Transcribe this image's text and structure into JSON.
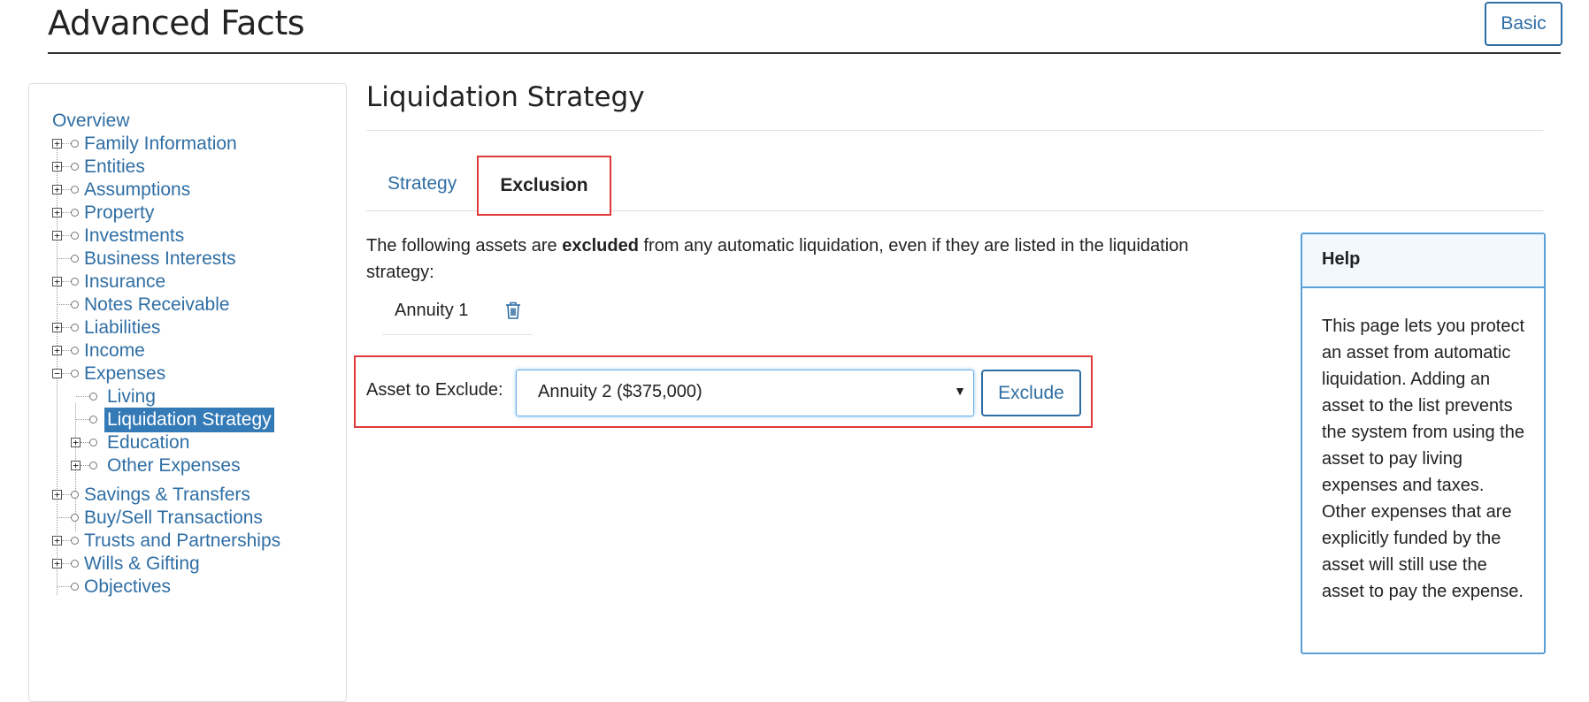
{
  "header": {
    "title": "Advanced Facts",
    "basic_label": "Basic"
  },
  "sidebar": {
    "items": [
      {
        "label": "Overview"
      },
      {
        "label": "Family Information"
      },
      {
        "label": "Entities"
      },
      {
        "label": "Assumptions"
      },
      {
        "label": "Property"
      },
      {
        "label": "Investments"
      },
      {
        "label": "Business Interests"
      },
      {
        "label": "Insurance"
      },
      {
        "label": "Notes Receivable"
      },
      {
        "label": "Liabilities"
      },
      {
        "label": "Income"
      },
      {
        "label": "Expenses"
      },
      {
        "label": "Living"
      },
      {
        "label": "Liquidation Strategy",
        "selected": true
      },
      {
        "label": "Education"
      },
      {
        "label": "Other Expenses"
      },
      {
        "label": "Savings & Transfers"
      },
      {
        "label": "Buy/Sell Transactions"
      },
      {
        "label": "Trusts and Partnerships"
      },
      {
        "label": "Wills & Gifting"
      },
      {
        "label": "Objectives"
      }
    ]
  },
  "main": {
    "title": "Liquidation Strategy",
    "tabs": [
      {
        "label": "Strategy"
      },
      {
        "label": "Exclusion",
        "active": true
      }
    ],
    "intro_before": "The following assets are ",
    "intro_bold": "excluded",
    "intro_after": " from any automatic liquidation, even if they are listed in the liquidation strategy:",
    "excluded_assets": [
      {
        "name": "Annuity 1"
      }
    ],
    "asset_to_exclude_label": "Asset to Exclude:",
    "asset_select_value": "Annuity 2 ($375,000)",
    "exclude_label": "Exclude"
  },
  "help": {
    "title": "Help",
    "body": "This page lets you protect an asset from automatic liquidation. Adding an asset to the list prevents the system from using the asset to pay living expenses and taxes. Other expenses that are explicitly funded by the asset will still use the asset to pay the expense."
  },
  "colors": {
    "link": "#2f6ea4",
    "selected_bg": "#337ab7",
    "highlight": "#e03a3a",
    "help_border": "#5a9fd6"
  },
  "icons": {
    "delete": "trash-icon",
    "expand": "plus-box-icon",
    "collapse": "minus-box-icon"
  }
}
